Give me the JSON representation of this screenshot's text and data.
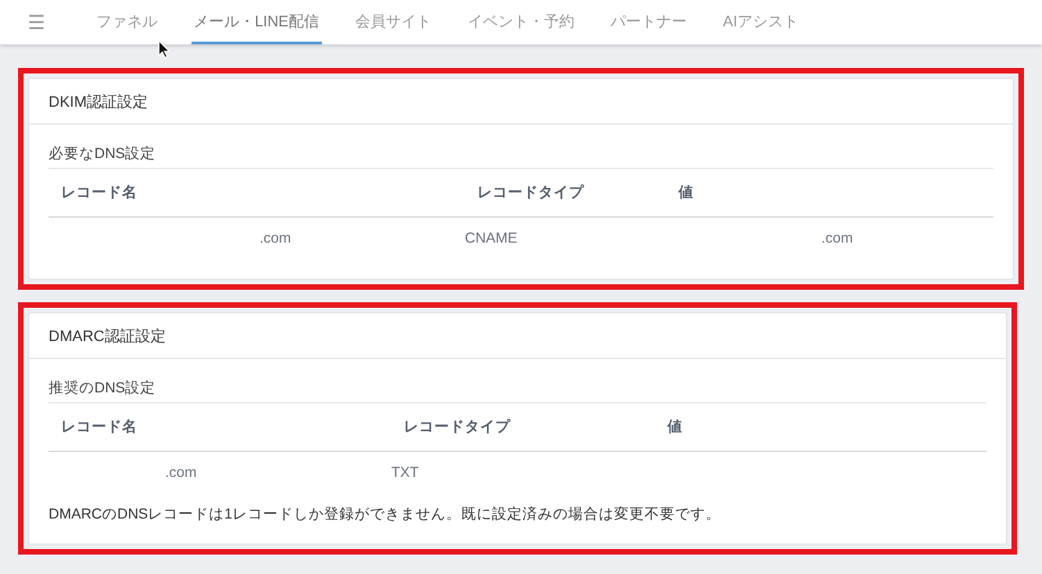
{
  "nav": {
    "menu_icon": "☰",
    "tabs": [
      {
        "label": "ファネル",
        "selected": false
      },
      {
        "label": "メール・LINE配信",
        "selected": true
      },
      {
        "label": "会員サイト",
        "selected": false
      },
      {
        "label": "イベント・予約",
        "selected": false
      },
      {
        "label": "パートナー",
        "selected": false
      },
      {
        "label": "AIアシスト",
        "selected": false
      }
    ]
  },
  "sections": [
    {
      "title": "DKIM認証設定",
      "highlighted": true,
      "subtitle": "必要なDNS設定",
      "columns": [
        "レコード名",
        "レコードタイプ",
        "値"
      ],
      "rows": [
        [
          ".com",
          "CNAME",
          ".com"
        ]
      ]
    },
    {
      "title": "DMARC認証設定",
      "highlighted": true,
      "subtitle": "推奨のDNS設定",
      "columns": [
        "レコード名",
        "レコードタイプ",
        "値"
      ],
      "rows": [
        [
          ".com",
          "TXT",
          ""
        ]
      ],
      "note": "DMARCのDNSレコードは1レコードしか登録ができません。既に設定済みの場合は変更不要です。"
    }
  ]
}
